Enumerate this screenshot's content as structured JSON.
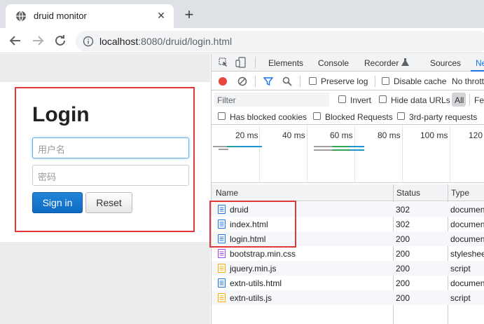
{
  "browser": {
    "tab_title": "druid monitor",
    "tab_close": "✕",
    "new_tab": "+",
    "url_host": "localhost",
    "url_rest": ":8080/druid/login.html"
  },
  "login": {
    "title": "Login",
    "username_placeholder": "用户名",
    "password_placeholder": "密码",
    "signin_label": "Sign in",
    "reset_label": "Reset"
  },
  "devtools": {
    "tabs": [
      "Elements",
      "Console",
      "Recorder",
      "Sources",
      "Ne"
    ],
    "toolbar": {
      "preserve_log": "Preserve log",
      "disable_cache": "Disable cache",
      "throttling": "No thrott"
    },
    "filter": {
      "placeholder": "Filter",
      "invert": "Invert",
      "hide_data_urls": "Hide data URLs",
      "all": "All",
      "fetch": "Fet",
      "has_blocked_cookies": "Has blocked cookies",
      "blocked_requests": "Blocked Requests",
      "third_party": "3rd-party requests"
    },
    "timeline_ticks": [
      "20 ms",
      "40 ms",
      "60 ms",
      "80 ms",
      "100 ms",
      "120"
    ],
    "columns": {
      "name": "Name",
      "status": "Status",
      "type": "Type"
    },
    "requests": [
      {
        "name": "druid",
        "status": "302",
        "type": "documen",
        "icon": "document-icon"
      },
      {
        "name": "index.html",
        "status": "302",
        "type": "documen",
        "icon": "document-icon"
      },
      {
        "name": "login.html",
        "status": "200",
        "type": "documen",
        "icon": "document-icon"
      },
      {
        "name": "bootstrap.min.css",
        "status": "200",
        "type": "styleshee",
        "icon": "stylesheet-icon"
      },
      {
        "name": "jquery.min.js",
        "status": "200",
        "type": "script",
        "icon": "script-icon"
      },
      {
        "name": "extn-utils.html",
        "status": "200",
        "type": "documen",
        "icon": "document-icon"
      },
      {
        "name": "extn-utils.js",
        "status": "200",
        "type": "script",
        "icon": "script-icon"
      }
    ]
  },
  "colors": {
    "highlight": "#e0393b",
    "record": "#e8453c",
    "signin": "#0d6ac4",
    "filter_active": "#1a73e8"
  }
}
